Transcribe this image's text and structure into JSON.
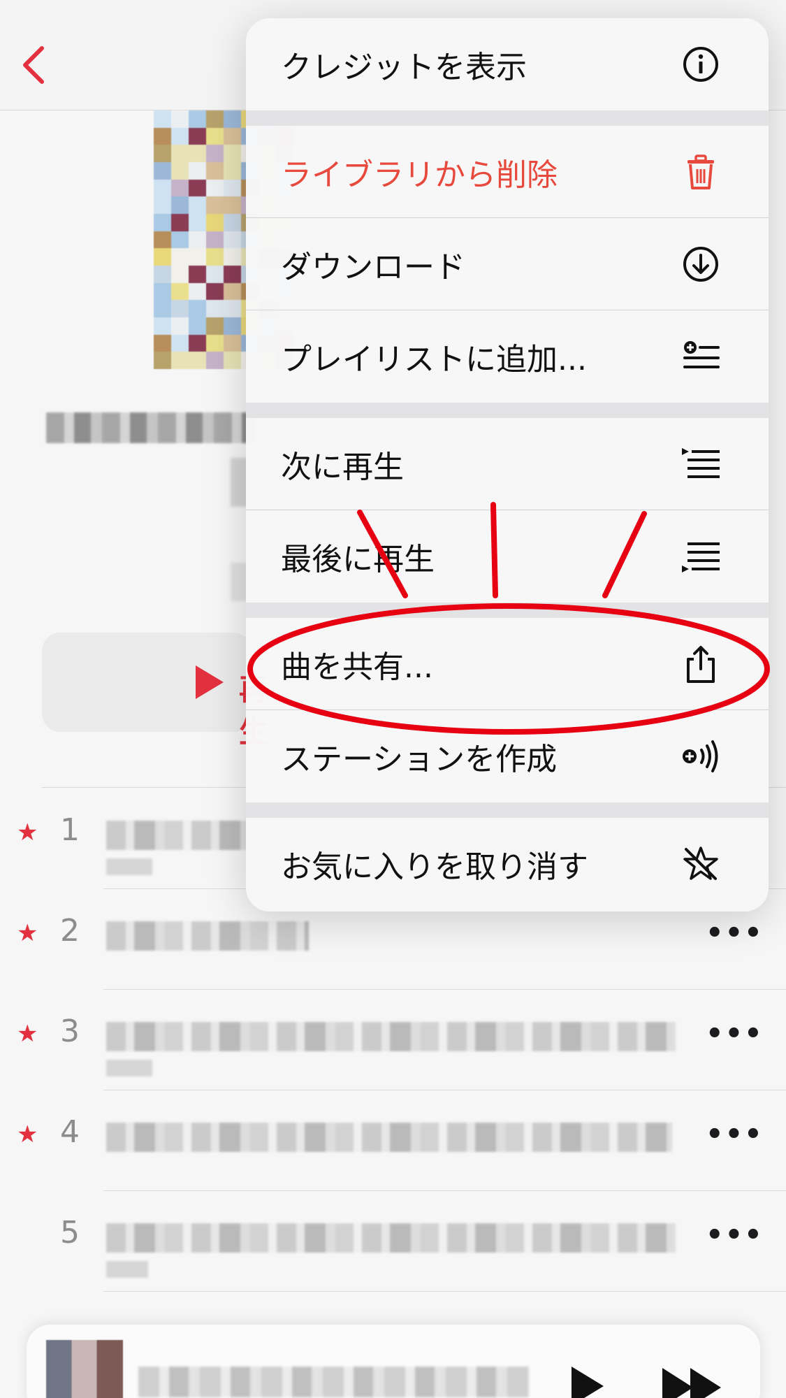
{
  "navbar": {
    "back_icon": "chevron-left-icon",
    "accent": "#e3303e"
  },
  "album": {
    "play_label": "再生"
  },
  "tracks": [
    {
      "number": "1",
      "favorited": true
    },
    {
      "number": "2",
      "favorited": true
    },
    {
      "number": "3",
      "favorited": true
    },
    {
      "number": "4",
      "favorited": true
    },
    {
      "number": "5",
      "favorited": false
    }
  ],
  "track_more_label": "•••",
  "menu": {
    "items": [
      {
        "label": "クレジットを表示",
        "icon": "info-circle-icon",
        "destructive": false
      },
      {
        "label": "ライブラリから削除",
        "icon": "trash-icon",
        "destructive": true
      },
      {
        "label": "ダウンロード",
        "icon": "download-circle-icon",
        "destructive": false
      },
      {
        "label": "プレイリストに追加...",
        "icon": "add-to-playlist-icon",
        "destructive": false
      },
      {
        "label": "次に再生",
        "icon": "play-next-icon",
        "destructive": false
      },
      {
        "label": "最後に再生",
        "icon": "play-last-icon",
        "destructive": false
      },
      {
        "label": "曲を共有...",
        "icon": "share-icon",
        "destructive": false,
        "highlighted": true
      },
      {
        "label": "ステーションを作成",
        "icon": "create-station-icon",
        "destructive": false
      },
      {
        "label": "お気に入りを取り消す",
        "icon": "unfavorite-star-icon",
        "destructive": false
      }
    ],
    "destructive_color": "#e8493d"
  },
  "annotation": {
    "color": "#e60012",
    "target": "曲を共有..."
  }
}
